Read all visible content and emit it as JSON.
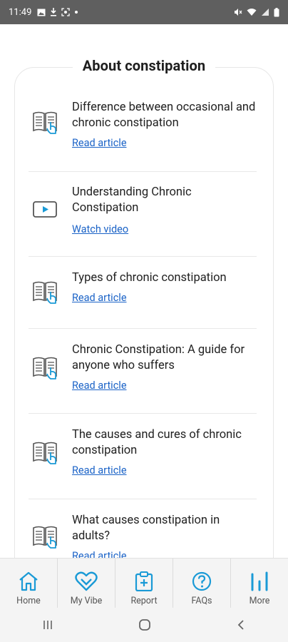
{
  "status": {
    "time": "11:49"
  },
  "section_title": "About constipation",
  "items": [
    {
      "title": "Difference between occasional and chronic constipation",
      "link": "Read article",
      "icon": "book-hand-icon"
    },
    {
      "title": "Understanding Chronic Constipation",
      "link": "Watch video",
      "icon": "video-play-icon"
    },
    {
      "title": "Types of chronic constipation",
      "link": "Read article",
      "icon": "book-hand-icon"
    },
    {
      "title": "Chronic Constipation: A guide for anyone who suffers",
      "link": "Read article",
      "icon": "book-hand-icon"
    },
    {
      "title": "The causes and cures of chronic constipation",
      "link": "Read article",
      "icon": "book-hand-icon"
    },
    {
      "title": "What causes constipation in adults?",
      "link": "Read article",
      "icon": "book-hand-icon"
    }
  ],
  "nav": [
    {
      "label": "Home",
      "icon": "home-icon"
    },
    {
      "label": "My Vibe",
      "icon": "heart-icon"
    },
    {
      "label": "Report",
      "icon": "clipboard-plus-icon"
    },
    {
      "label": "FAQs",
      "icon": "question-icon"
    },
    {
      "label": "More",
      "icon": "bar-chart-icon"
    }
  ],
  "colors": {
    "accent": "#1a9ad6",
    "link": "#1b63c7",
    "statusbar": "#5f5f5f"
  }
}
